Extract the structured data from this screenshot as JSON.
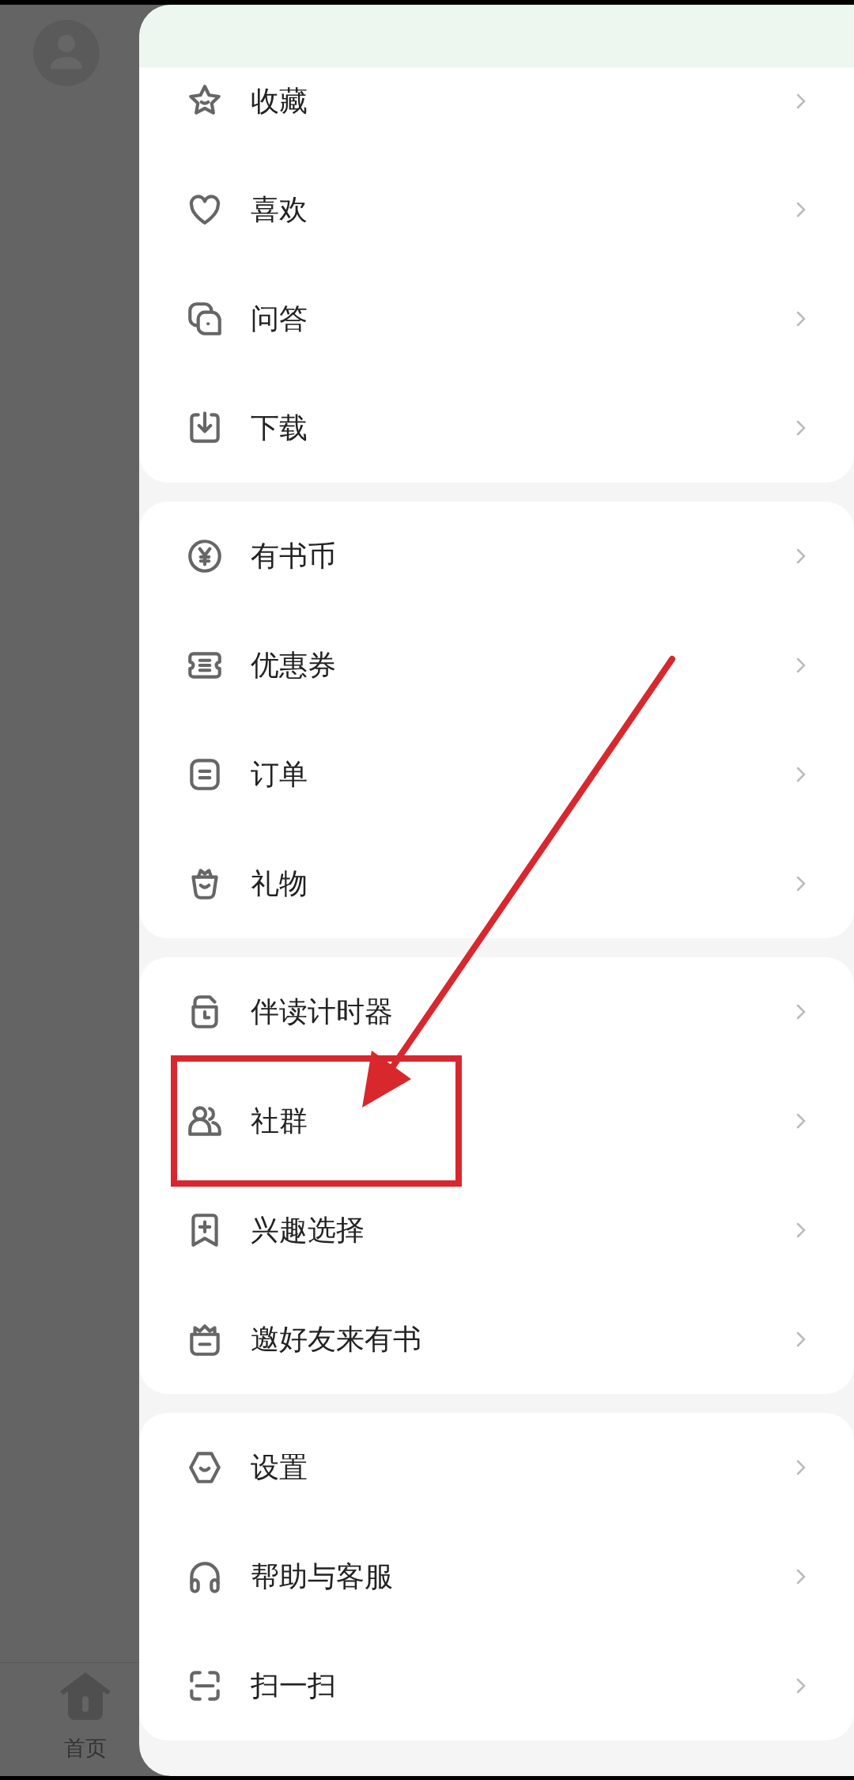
{
  "background_page": {
    "nav_label": "首页"
  },
  "drawer": {
    "groups": [
      {
        "items": [
          {
            "label": "收藏",
            "highlighted": false
          },
          {
            "label": "喜欢",
            "highlighted": false
          },
          {
            "label": "问答",
            "highlighted": false
          },
          {
            "label": "下载",
            "highlighted": false
          }
        ]
      },
      {
        "items": [
          {
            "label": "有书币",
            "highlighted": false
          },
          {
            "label": "优惠券",
            "highlighted": false
          },
          {
            "label": "订单",
            "highlighted": false
          },
          {
            "label": "礼物",
            "highlighted": false
          }
        ]
      },
      {
        "items": [
          {
            "label": "伴读计时器",
            "highlighted": false
          },
          {
            "label": "社群",
            "highlighted": true
          },
          {
            "label": "兴趣选择",
            "highlighted": false
          },
          {
            "label": "邀好友来有书",
            "highlighted": false
          }
        ]
      },
      {
        "items": [
          {
            "label": "设置",
            "highlighted": false
          },
          {
            "label": "帮助与客服",
            "highlighted": false
          },
          {
            "label": "扫一扫",
            "highlighted": false
          }
        ]
      }
    ]
  }
}
